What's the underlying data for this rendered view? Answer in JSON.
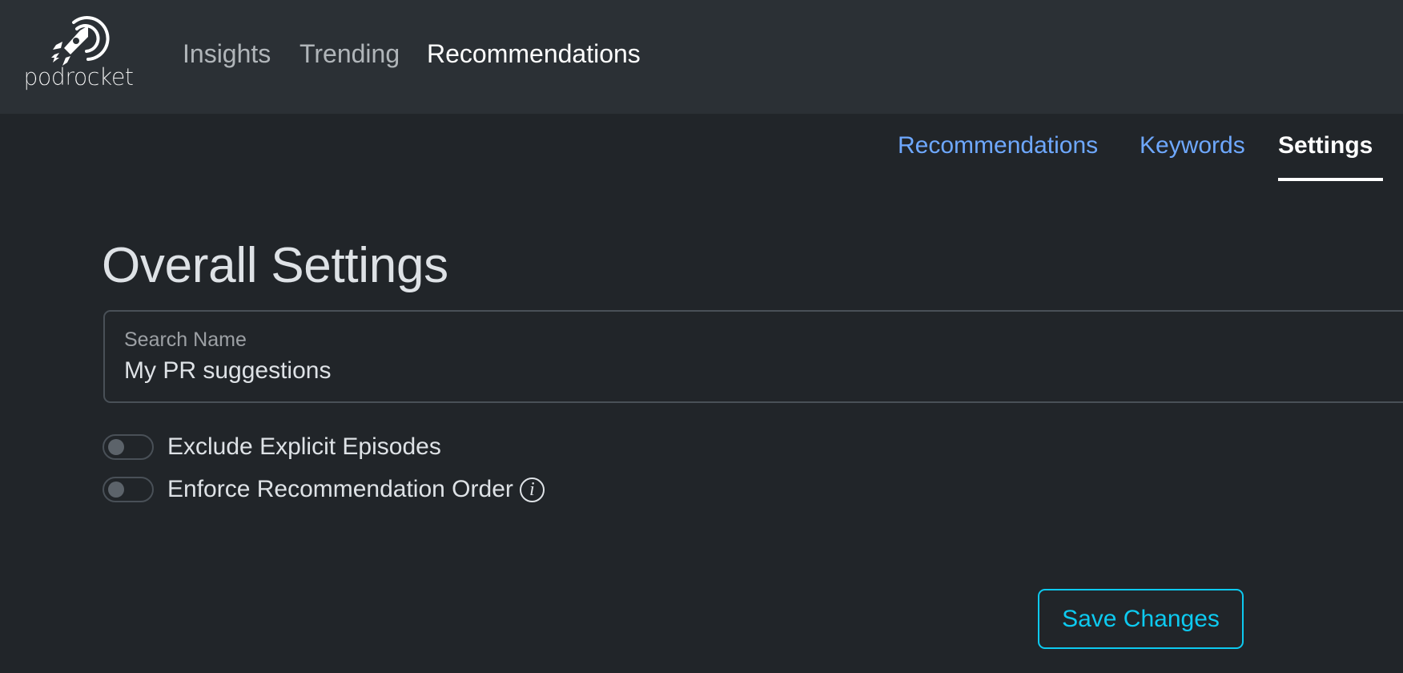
{
  "brand": {
    "name": "podrocket",
    "logo_icon": "rocket-target-icon"
  },
  "main_nav": [
    {
      "label": "Insights",
      "active": false
    },
    {
      "label": "Trending",
      "active": false
    },
    {
      "label": "Recommendations",
      "active": true
    }
  ],
  "sub_nav": [
    {
      "label": "Recommendations",
      "active": false
    },
    {
      "label": "Keywords",
      "active": false
    },
    {
      "label": "Settings",
      "active": true
    }
  ],
  "page": {
    "title": "Overall Settings"
  },
  "form": {
    "search_name": {
      "label": "Search Name",
      "value": "My PR suggestions"
    },
    "toggles": [
      {
        "label": "Exclude Explicit Episodes",
        "checked": false,
        "info_icon": false
      },
      {
        "label": "Enforce Recommendation Order",
        "checked": false,
        "info_icon": true
      }
    ],
    "info_icon_glyph": "i",
    "save_label": "Save Changes"
  },
  "colors": {
    "header_bg": "#2b3035",
    "body_bg": "#212529",
    "link": "#6ea8fe",
    "accent_info": "#0dcaf0",
    "text": "#dee2e6"
  }
}
